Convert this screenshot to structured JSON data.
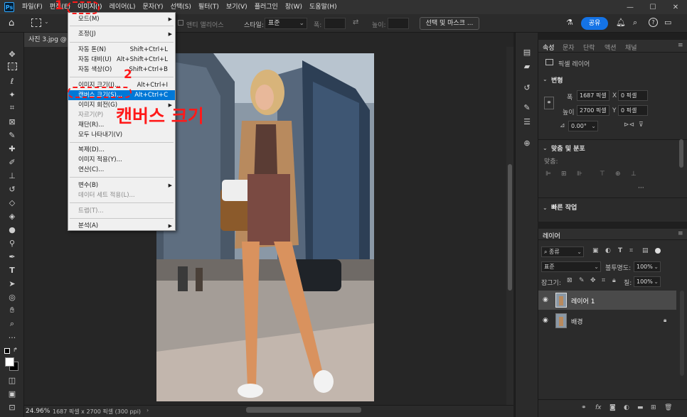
{
  "menubar": {
    "logo": "Ps",
    "items": [
      "파일(F)",
      "편집(E)",
      "이미지(I)",
      "레이어(L)",
      "문자(Y)",
      "선택(S)",
      "필터(T)",
      "보기(V)",
      "플러그인",
      "창(W)",
      "도움말(H)"
    ]
  },
  "optionsbar": {
    "antialias_label": "앤티 앨리어스",
    "style_label": "스타일:",
    "style_value": "표준",
    "width_label": "폭:",
    "height_label": "높이:",
    "select_mask": "선택 및 마스크 ...",
    "share": "공유"
  },
  "tab": {
    "title": "사진 3.jpg @ 2"
  },
  "status": {
    "zoom": "24.96%",
    "info": "1687 픽셀 x 2700 픽셀 (300 ppi)"
  },
  "dropdown": {
    "items": [
      {
        "label": "모드(M)",
        "shortcut": "",
        "submenu": true,
        "disabled": false
      },
      {
        "label": "조정(J)",
        "shortcut": "",
        "submenu": true,
        "disabled": false
      },
      {
        "label": "자동 톤(N)",
        "shortcut": "Shift+Ctrl+L",
        "submenu": false,
        "disabled": false
      },
      {
        "label": "자동 대비(U)",
        "shortcut": "Alt+Shift+Ctrl+L",
        "submenu": false,
        "disabled": false
      },
      {
        "label": "자동 색상(O)",
        "shortcut": "Shift+Ctrl+B",
        "submenu": false,
        "disabled": false
      },
      {
        "label": "이미지 크기(I)...",
        "shortcut": "Alt+Ctrl+I",
        "submenu": false,
        "disabled": false
      },
      {
        "label": "캔버스 크기(S)...",
        "shortcut": "Alt+Ctrl+C",
        "submenu": false,
        "disabled": false,
        "highlight": true
      },
      {
        "label": "이미지 회전(G)",
        "shortcut": "",
        "submenu": true,
        "disabled": false
      },
      {
        "label": "자르기(P)",
        "shortcut": "",
        "submenu": false,
        "disabled": true
      },
      {
        "label": "재단(R)...",
        "shortcut": "",
        "submenu": false,
        "disabled": false
      },
      {
        "label": "모두 나타내기(V)",
        "shortcut": "",
        "submenu": false,
        "disabled": false
      },
      {
        "label": "복제(D)...",
        "shortcut": "",
        "submenu": false,
        "disabled": false
      },
      {
        "label": "이미지 적용(Y)...",
        "shortcut": "",
        "submenu": false,
        "disabled": false
      },
      {
        "label": "연산(C)...",
        "shortcut": "",
        "submenu": false,
        "disabled": false
      },
      {
        "label": "변수(B)",
        "shortcut": "",
        "submenu": true,
        "disabled": false
      },
      {
        "label": "데이터 세트 적용(L)...",
        "shortcut": "",
        "submenu": false,
        "disabled": true
      },
      {
        "label": "트랩(T)...",
        "shortcut": "",
        "submenu": false,
        "disabled": true
      },
      {
        "label": "분석(A)",
        "shortcut": "",
        "submenu": true,
        "disabled": false
      }
    ]
  },
  "annotations": {
    "step1": "1",
    "step2": "2",
    "caption": "캔버스 크기"
  },
  "properties": {
    "tabs": [
      "속성",
      "문자",
      "단락",
      "액션",
      "채널"
    ],
    "pixel_layer": "픽셀 레이어",
    "transform_title": "변형",
    "w_label": "폭",
    "w_value": "1687 픽셀",
    "x_label": "X",
    "x_value": "0 픽셀",
    "h_label": "높이",
    "h_value": "2700 픽셀",
    "y_label": "Y",
    "y_value": "0 픽셀",
    "angle_value": "0.00°",
    "align_title": "맞춤 및 분포",
    "align_label": "맞춤:",
    "quick_title": "빠른 작업"
  },
  "layers": {
    "title": "레이어",
    "filter_value": "종류",
    "blend_value": "표준",
    "opacity_label": "불투명도:",
    "opacity_value": "100%",
    "lock_label": "잠그기:",
    "fill_label": "칠:",
    "fill_value": "100%",
    "rows": [
      {
        "name": "레이어 1",
        "selected": true
      },
      {
        "name": "배경",
        "selected": false
      }
    ]
  }
}
